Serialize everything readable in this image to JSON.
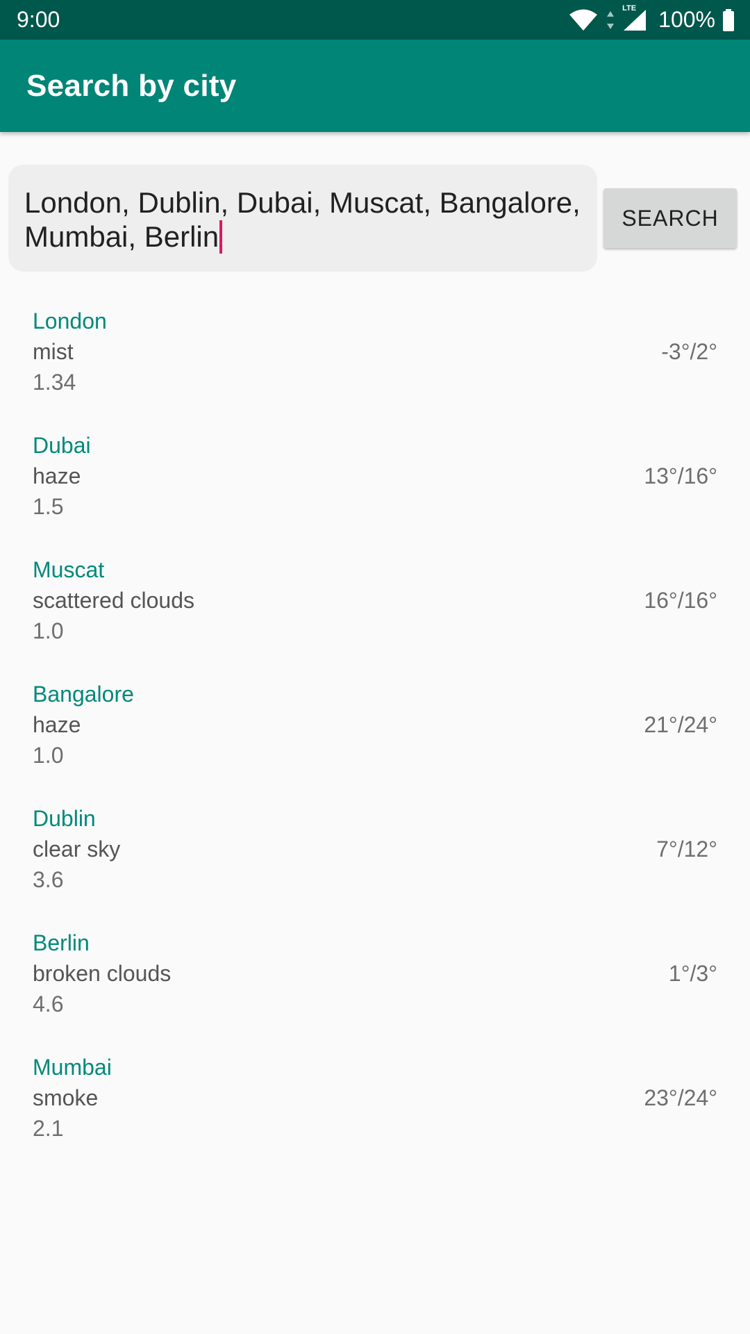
{
  "status_bar": {
    "time": "9:00",
    "network": "LTE",
    "battery": "100%",
    "icons": [
      "wifi-icon",
      "data-arrows-icon",
      "cell-signal-icon",
      "battery-icon"
    ]
  },
  "app_bar": {
    "title": "Search by city"
  },
  "search": {
    "value": "London, Dublin, Dubai, Muscat, Bangalore, Mumbai, Berlin",
    "button_label": "SEARCH"
  },
  "cities": [
    {
      "name": "London",
      "description": "mist",
      "wind": "1.34",
      "temp": "-3°/2°"
    },
    {
      "name": "Dubai",
      "description": "haze",
      "wind": "1.5",
      "temp": "13°/16°"
    },
    {
      "name": "Muscat",
      "description": "scattered clouds",
      "wind": "1.0",
      "temp": "16°/16°"
    },
    {
      "name": "Bangalore",
      "description": "haze",
      "wind": "1.0",
      "temp": "21°/24°"
    },
    {
      "name": "Dublin",
      "description": "clear sky",
      "wind": "3.6",
      "temp": "7°/12°"
    },
    {
      "name": "Berlin",
      "description": "broken clouds",
      "wind": "4.6",
      "temp": "1°/3°"
    },
    {
      "name": "Mumbai",
      "description": "smoke",
      "wind": "2.1",
      "temp": "23°/24°"
    }
  ],
  "colors": {
    "status_bar": "#00574B",
    "primary": "#008577",
    "accent": "#D81B60",
    "city_name": "#00897B"
  }
}
